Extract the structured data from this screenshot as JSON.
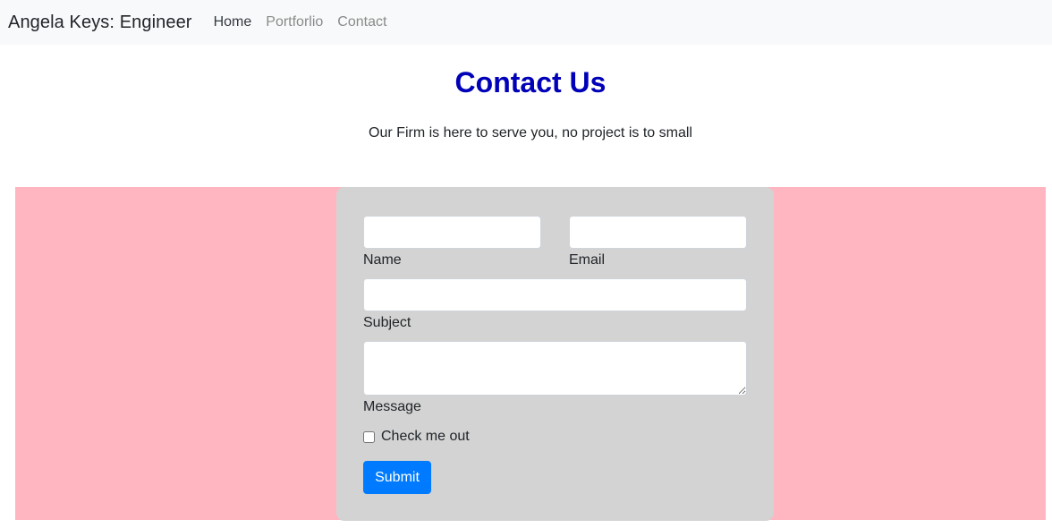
{
  "navbar": {
    "brand": "Angela Keys: Engineer",
    "links": [
      {
        "label": "Home",
        "active": true
      },
      {
        "label": "Portforlio",
        "active": false
      },
      {
        "label": "Contact",
        "active": false
      }
    ]
  },
  "header": {
    "title": "Contact Us",
    "subtitle": "Our Firm is here to serve you, no project is to small"
  },
  "form": {
    "name": {
      "label": "Name",
      "value": ""
    },
    "email": {
      "label": "Email",
      "value": ""
    },
    "subject": {
      "label": "Subject",
      "value": ""
    },
    "message": {
      "label": "Message",
      "value": ""
    },
    "checkbox": {
      "label": "Check me out",
      "checked": false
    },
    "submit_label": "Submit"
  },
  "colors": {
    "title": "#0000b8",
    "band": "#ffb6c1",
    "card": "#d3d3d3",
    "button": "#007bff"
  }
}
